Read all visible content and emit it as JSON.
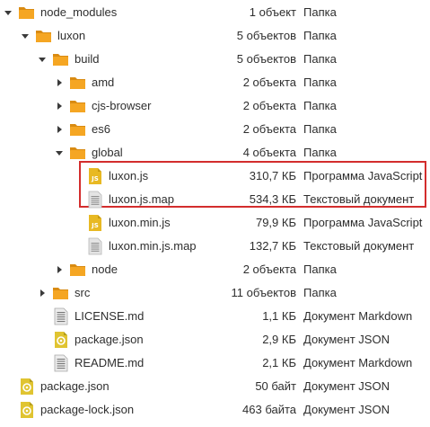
{
  "colors": {
    "folder": "#f5a623",
    "folder_tab": "#d98b12",
    "js_icon": "#e8b923",
    "json_icon": "#e0c431",
    "text_icon": "#e4e4e4",
    "highlight": "#d32d2d"
  },
  "rows": [
    {
      "name": "node_modules",
      "size": "1 объект",
      "type": "Папка",
      "icon": "folder-icon",
      "expander": "chevron-down-icon"
    },
    {
      "name": "luxon",
      "size": "5 объектов",
      "type": "Папка",
      "icon": "folder-icon",
      "expander": "chevron-down-icon"
    },
    {
      "name": "build",
      "size": "5 объектов",
      "type": "Папка",
      "icon": "folder-icon",
      "expander": "chevron-down-icon"
    },
    {
      "name": "amd",
      "size": "2 объекта",
      "type": "Папка",
      "icon": "folder-icon",
      "expander": "chevron-right-icon"
    },
    {
      "name": "cjs-browser",
      "size": "2 объекта",
      "type": "Папка",
      "icon": "folder-icon",
      "expander": "chevron-right-icon"
    },
    {
      "name": "es6",
      "size": "2 объекта",
      "type": "Папка",
      "icon": "folder-icon",
      "expander": "chevron-right-icon"
    },
    {
      "name": "global",
      "size": "4 объекта",
      "type": "Папка",
      "icon": "folder-icon",
      "expander": "chevron-down-icon"
    },
    {
      "name": "luxon.js",
      "size": "310,7 КБ",
      "type": "Программа JavaScript",
      "icon": "javascript-file-icon",
      "js_badge": "JS"
    },
    {
      "name": "luxon.js.map",
      "size": "534,3 КБ",
      "type": "Текстовый документ",
      "icon": "text-file-icon"
    },
    {
      "name": "luxon.min.js",
      "size": "79,9 КБ",
      "type": "Программа JavaScript",
      "icon": "javascript-file-icon",
      "js_badge": "JS"
    },
    {
      "name": "luxon.min.js.map",
      "size": "132,7 КБ",
      "type": "Текстовый документ",
      "icon": "text-file-icon"
    },
    {
      "name": "node",
      "size": "2 объекта",
      "type": "Папка",
      "icon": "folder-icon",
      "expander": "chevron-right-icon"
    },
    {
      "name": "src",
      "size": "11 объектов",
      "type": "Папка",
      "icon": "folder-icon",
      "expander": "chevron-right-icon"
    },
    {
      "name": "LICENSE.md",
      "size": "1,1 КБ",
      "type": "Документ Markdown",
      "icon": "markdown-file-icon"
    },
    {
      "name": "package.json",
      "size": "2,9 КБ",
      "type": "Документ JSON",
      "icon": "json-file-icon"
    },
    {
      "name": "README.md",
      "size": "2,1 КБ",
      "type": "Документ Markdown",
      "icon": "markdown-file-icon"
    },
    {
      "name": "package.json",
      "size": "50 байт",
      "type": "Документ JSON",
      "icon": "json-file-icon"
    },
    {
      "name": "package-lock.json",
      "size": "463 байта",
      "type": "Документ JSON",
      "icon": "json-file-icon"
    }
  ]
}
